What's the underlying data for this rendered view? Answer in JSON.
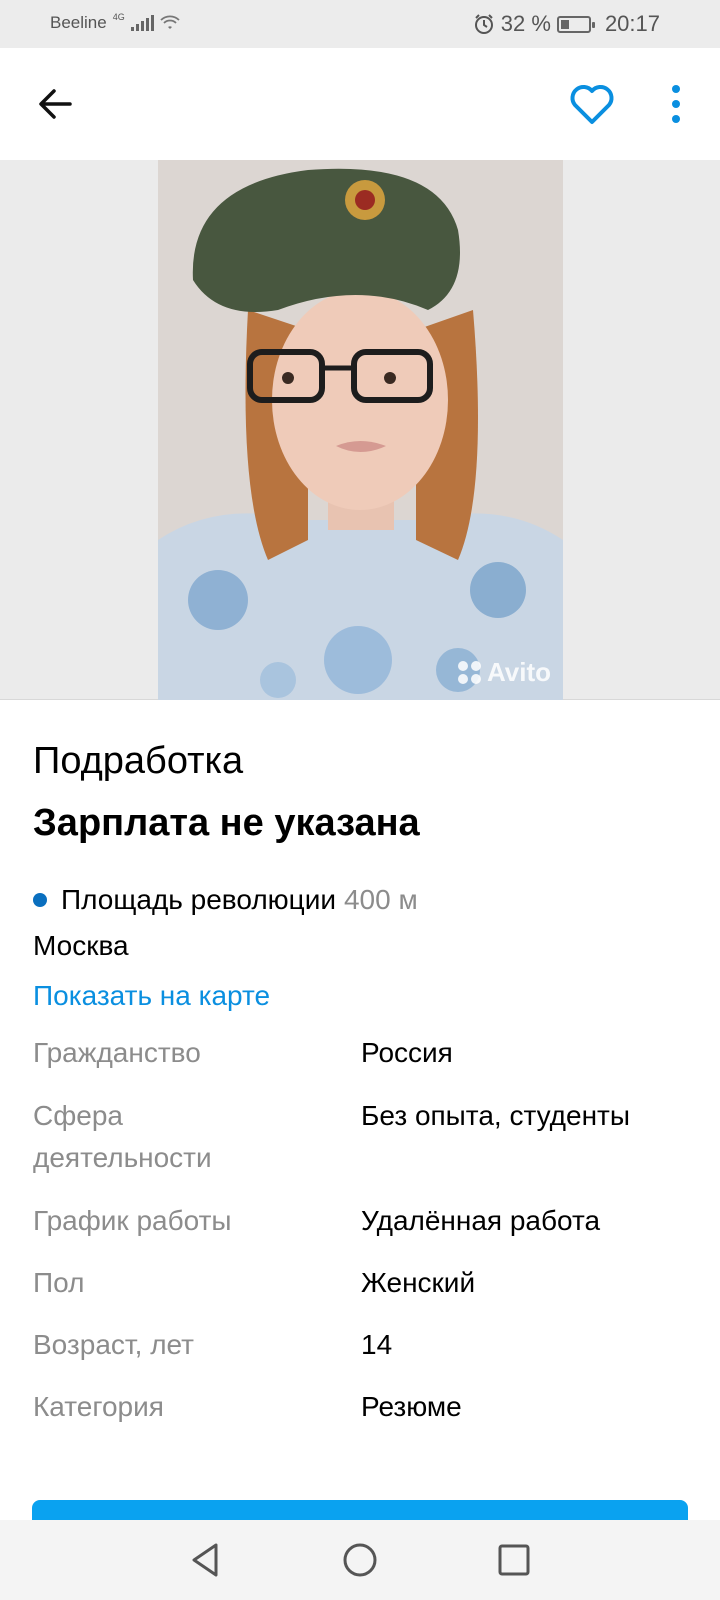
{
  "status_bar": {
    "carrier": "Beeline",
    "network": "4G",
    "battery_percent": "32 %",
    "battery_level": 0.32,
    "time": "20:17"
  },
  "app_bar": {
    "back_icon": "arrow-left-icon",
    "favorite_icon": "heart-outline-icon",
    "more_icon": "more-vertical-icon"
  },
  "photo": {
    "watermark": "Avito"
  },
  "listing": {
    "title": "Подработка",
    "salary": "Зарплата не указана",
    "metro_station": "Площадь революции",
    "metro_distance": "400 м",
    "city": "Москва",
    "map_link": "Показать на карте"
  },
  "params": [
    {
      "key": "Гражданство",
      "value": "Россия"
    },
    {
      "key": "Сфера деятельности",
      "value": "Без опыта, студенты"
    },
    {
      "key": "График работы",
      "value": "Удалённая работа"
    },
    {
      "key": "Пол",
      "value": "Женский"
    },
    {
      "key": "Возраст, лет",
      "value": "14"
    },
    {
      "key": "Категория",
      "value": "Резюме"
    }
  ],
  "colors": {
    "accent": "#0a8fe0",
    "metro_line": "#0a6fbf",
    "cta": "#0aa2f0",
    "secondary_text": "#8c8c8c"
  }
}
